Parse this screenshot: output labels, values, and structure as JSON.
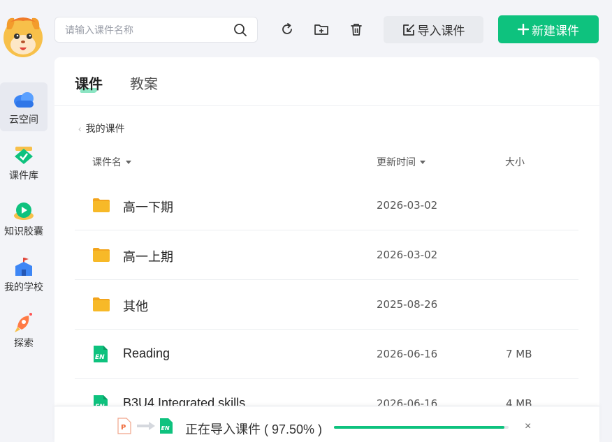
{
  "search": {
    "placeholder": "请输入课件名称"
  },
  "toolbar": {
    "import_label": "导入课件",
    "new_label": "新建课件"
  },
  "nav": [
    {
      "label": "云空间",
      "icon": "cloud-icon"
    },
    {
      "label": "课件库",
      "icon": "courseware-library-icon"
    },
    {
      "label": "知识胶囊",
      "icon": "knowledge-capsule-icon"
    },
    {
      "label": "我的学校",
      "icon": "school-icon"
    },
    {
      "label": "探索",
      "icon": "rocket-icon"
    }
  ],
  "tabs": {
    "courseware": "课件",
    "lesson_plan": "教案"
  },
  "breadcrumb": {
    "label": "我的课件"
  },
  "table": {
    "col_name": "课件名",
    "col_updated": "更新时间",
    "col_size": "大小",
    "rows": [
      {
        "name": "高一下期",
        "date": "2026-03-02",
        "size": "",
        "type": "folder"
      },
      {
        "name": "高一上期",
        "date": "2026-03-02",
        "size": "",
        "type": "folder"
      },
      {
        "name": "其他",
        "date": "2025-08-26",
        "size": "",
        "type": "folder"
      },
      {
        "name": "Reading",
        "date": "2026-06-16",
        "size": "7 MB",
        "type": "en-file"
      },
      {
        "name": "B3U4 Integrated skills",
        "date": "2026-06-16",
        "size": "4 MB",
        "type": "en-file"
      }
    ]
  },
  "import_progress": {
    "text": "正在导入课件 ( 97.50% )",
    "progress": 0.975,
    "close_label": "×"
  },
  "colors": {
    "accent": "#0ec27e",
    "folder": "#f7b928",
    "background": "#f3f4f8"
  }
}
